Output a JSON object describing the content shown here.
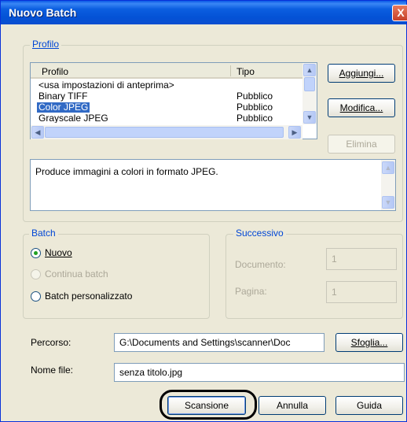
{
  "window": {
    "title": "Nuovo Batch",
    "close_glyph": "X"
  },
  "profilo": {
    "group_label": "Profilo",
    "columns": [
      "Profilo",
      "Tipo"
    ],
    "rows": [
      {
        "name": "<usa impostazioni di anteprima>",
        "type": ""
      },
      {
        "name": "Binary TIFF",
        "type": "Pubblico"
      },
      {
        "name": "Color JPEG",
        "type": "Pubblico"
      },
      {
        "name": "Grayscale JPEG",
        "type": "Pubblico"
      }
    ],
    "selected_index": 2,
    "description": "Produce immagini a colori in formato JPEG.",
    "buttons": {
      "add": "Aggiungi...",
      "edit": "Modifica...",
      "delete": "Elimina"
    }
  },
  "batch": {
    "group_label": "Batch",
    "options": {
      "new": "Nuovo",
      "continue": "Continua batch",
      "custom": "Batch personalizzato"
    },
    "selected": "new"
  },
  "successivo": {
    "group_label": "Successivo",
    "document_label": "Documento:",
    "document_value": "1",
    "page_label": "Pagina:",
    "page_value": "1"
  },
  "percorso": {
    "label": "Percorso:",
    "value": "G:\\Documents and Settings\\scanner\\Doc",
    "browse": "Sfoglia..."
  },
  "nome_file": {
    "label": "Nome file:",
    "value": "senza titolo.jpg"
  },
  "footer": {
    "scan": "Scansione",
    "cancel": "Annulla",
    "help": "Guida"
  },
  "colors": {
    "accent": "#0046d5",
    "selection": "#316ac5",
    "highlight_circle": "#000000"
  }
}
